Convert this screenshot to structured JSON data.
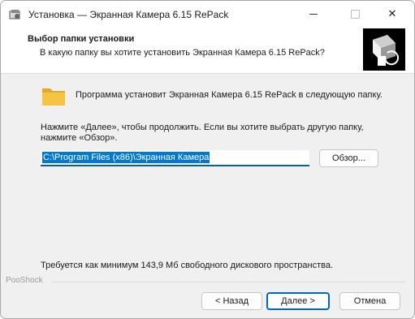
{
  "window": {
    "title": "Установка — Экранная Камера 6.15 RePack",
    "controls": {
      "minimize": "minimize",
      "maximize": "maximize",
      "close": "✕"
    }
  },
  "header": {
    "title": "Выбор папки установки",
    "subtitle": "В какую папку вы хотите установить Экранная Камера 6.15 RePack?"
  },
  "body": {
    "lead": "Программа установит Экранная Камера 6.15 RePack в следующую папку.",
    "hint": "Нажмите «Далее», чтобы продолжить. Если вы хотите выбрать другую папку, нажмите «Обзор».",
    "path_value": "C:\\Program Files (x86)\\Экранная Камера",
    "browse_label": "Обзор...",
    "space_text": "Требуется как минимум 143,9 Мб свободного дискового пространства."
  },
  "footer": {
    "brand": "PooShock",
    "back_label": "< Назад",
    "next_label": "Далее >",
    "cancel_label": "Отмена"
  },
  "colors": {
    "accent": "#005fb8",
    "selection": "#0078d7",
    "folder": "#f6c443"
  },
  "icons": [
    "app-icon",
    "installer-logo-icon",
    "folder-icon"
  ]
}
